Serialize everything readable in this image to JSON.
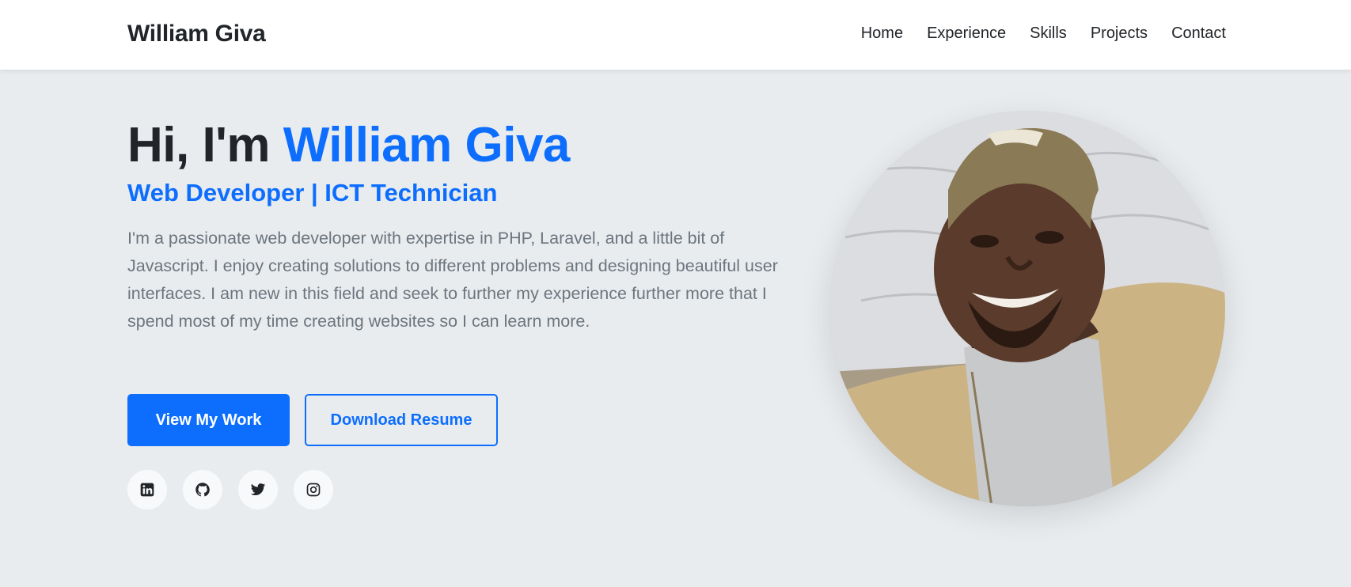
{
  "nav": {
    "brand": "William Giva",
    "links": [
      "Home",
      "Experience",
      "Skills",
      "Projects",
      "Contact"
    ]
  },
  "hero": {
    "greeting": "Hi, I'm ",
    "name": "William Giva",
    "subtitle": "Web Developer | ICT Technician",
    "description": "I'm a passionate web developer with expertise in PHP, Laravel, and a little bit of Javascript. I enjoy creating solutions to different problems and designing beautiful user interfaces. I am new in this field and seek to further my experience further more that I spend most of my time creating websites so I can learn more.",
    "primary_button": "View My Work",
    "secondary_button": "Download Resume"
  },
  "socials": [
    "linkedin-icon",
    "github-icon",
    "twitter-icon",
    "instagram-icon"
  ],
  "colors": {
    "accent": "#0d6efd",
    "text": "#212529",
    "muted": "#6c757d",
    "background": "#e9ecef"
  }
}
